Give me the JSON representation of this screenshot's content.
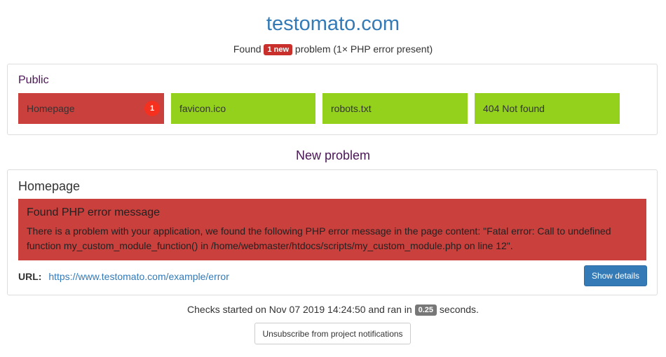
{
  "site": {
    "title": "testomato.com"
  },
  "summary": {
    "prefix": "Found",
    "badge": "1 new",
    "suffix": "problem (1× PHP error present)"
  },
  "public_panel": {
    "title": "Public",
    "checks": [
      {
        "label": "Homepage",
        "status": "error",
        "count": "1"
      },
      {
        "label": "favicon.ico",
        "status": "ok"
      },
      {
        "label": "robots.txt",
        "status": "ok"
      },
      {
        "label": "404 Not found",
        "status": "ok"
      }
    ]
  },
  "new_problem": {
    "heading": "New problem",
    "page": "Homepage",
    "error_title": "Found PHP error message",
    "error_text": "There is a problem with your application, we found the following PHP error message in the page content: \"Fatal error: Call to undefined function my_custom_module_function() in /home/webmaster/htdocs/scripts/my_custom_module.php on line 12\".",
    "url_label": "URL:",
    "url": "https://www.testomato.com/example/error",
    "details_button": "Show details"
  },
  "footer": {
    "checks_prefix": "Checks started on Nov 07 2019 14:24:50 and ran in",
    "duration": "0.25",
    "checks_suffix": "seconds.",
    "unsubscribe_button": "Unsubscribe from project notifications"
  },
  "colors": {
    "link": "#337ab7",
    "error": "#c9403d",
    "ok": "#94d11d",
    "heading": "#4a1555"
  }
}
